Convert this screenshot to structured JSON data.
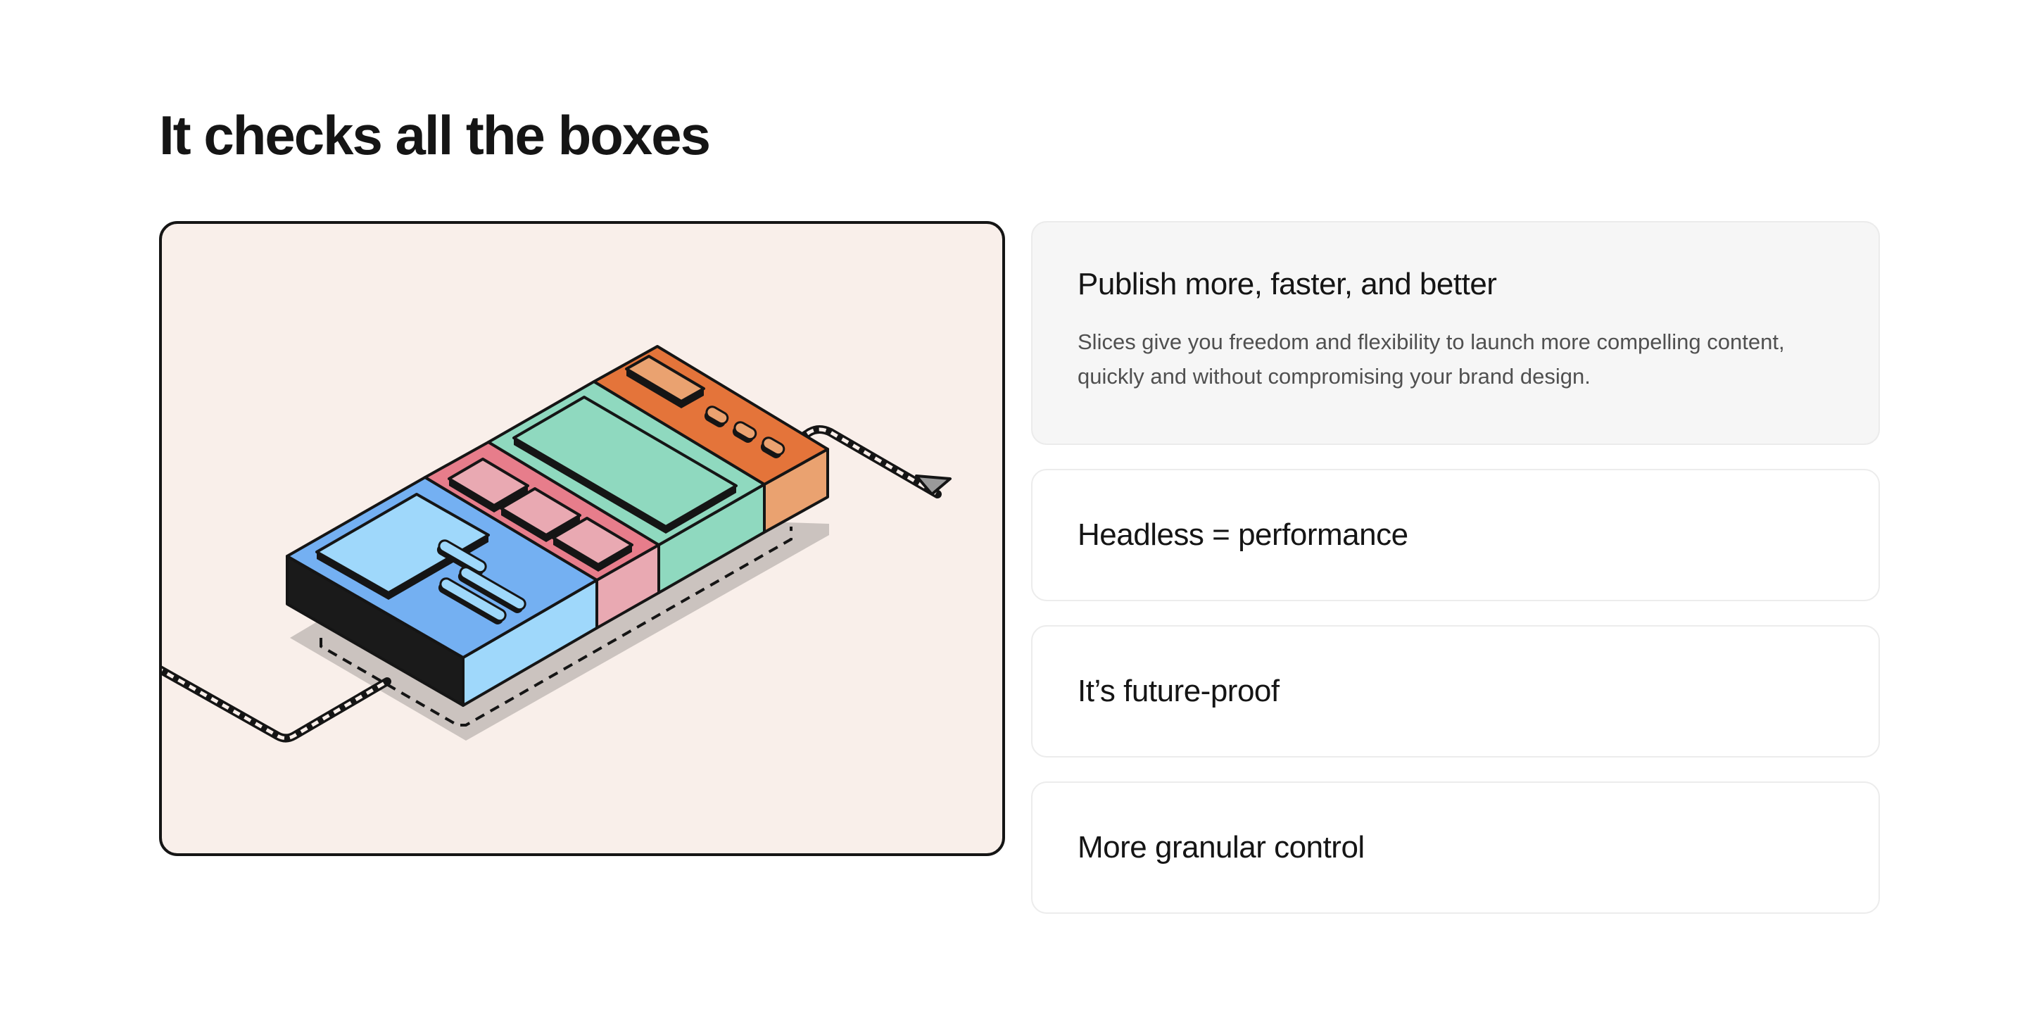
{
  "section": {
    "title": "It checks all the boxes"
  },
  "illustration": {
    "background_color": "#f9efea",
    "icon": "isometric-slices-blocks-illustration"
  },
  "accordion": {
    "items": [
      {
        "title": "Publish more, faster, and better",
        "body": "Slices give you freedom and flexibility to launch more compelling content, quickly and without compromising your brand design.",
        "expanded": true
      },
      {
        "title": "Headless = performance",
        "expanded": false
      },
      {
        "title": "It’s future-proof",
        "expanded": false
      },
      {
        "title": "More granular control",
        "expanded": false
      }
    ]
  },
  "colors": {
    "blue": "#74b0f2",
    "light_blue": "#9fd8fb",
    "pink": "#e77d8b",
    "light_pink": "#e9a9b2",
    "green": "#8fd9bf",
    "orange": "#e4743a",
    "light_orange": "#eaa270",
    "dark": "#151515"
  }
}
